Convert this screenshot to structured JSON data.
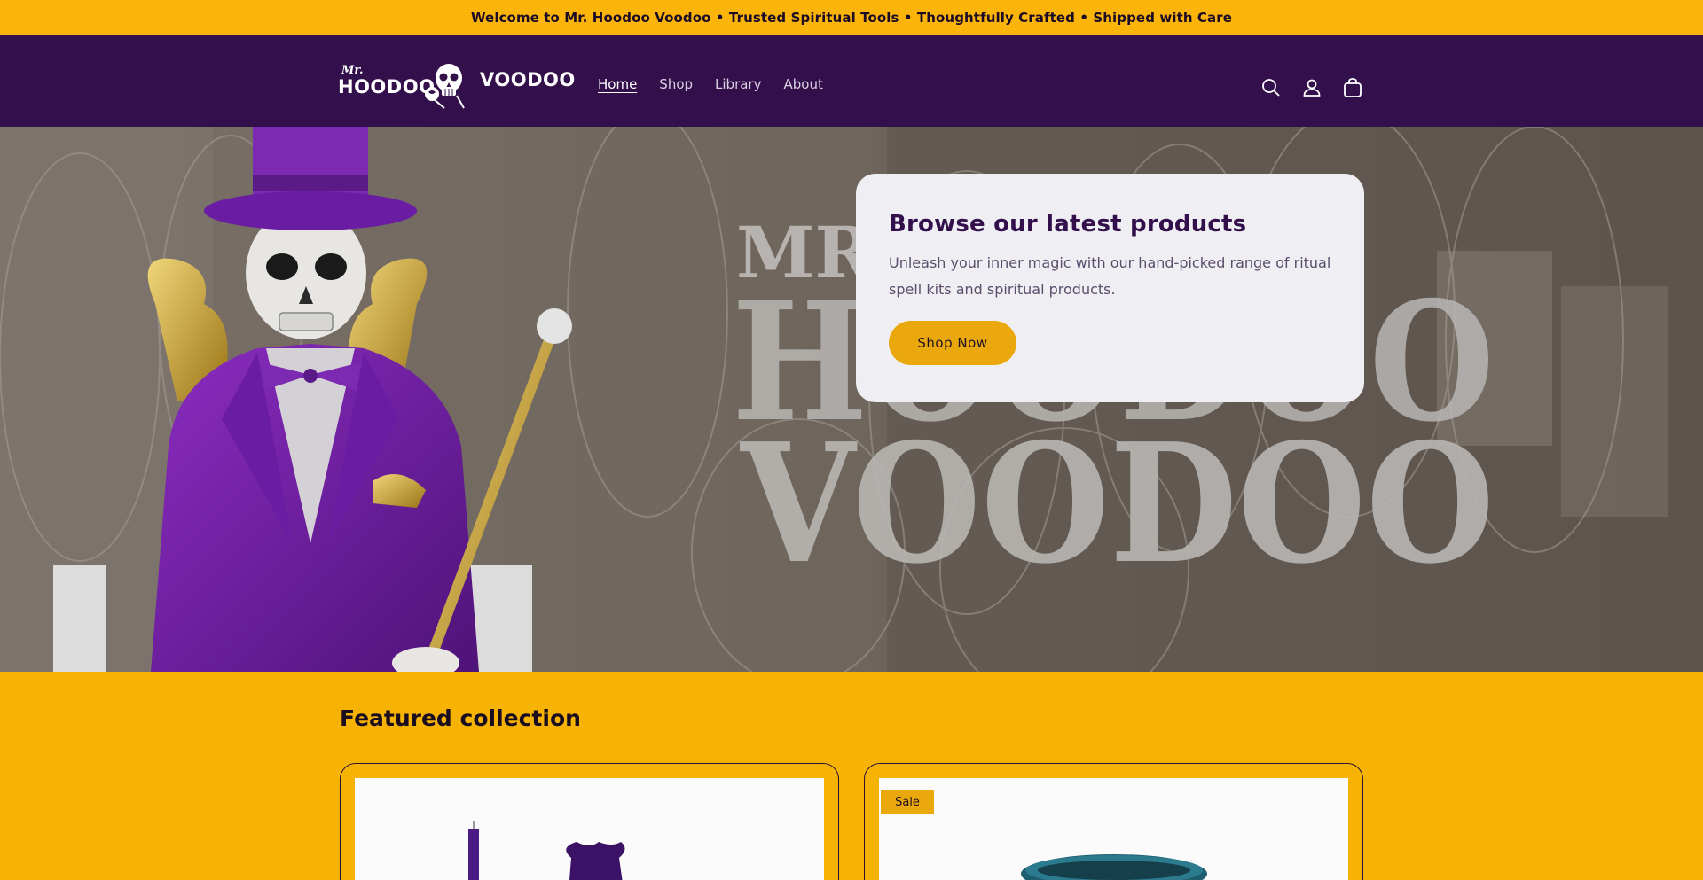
{
  "announcement": "Welcome to Mr. Hoodoo Voodoo • Trusted Spiritual Tools • Thoughtfully Crafted • Shipped with Care",
  "logo": {
    "mr": "Mr.",
    "word1": "HOODOO",
    "word2": "VOODOO"
  },
  "nav": [
    {
      "label": "Home",
      "active": true
    },
    {
      "label": "Shop",
      "active": false
    },
    {
      "label": "Library",
      "active": false
    },
    {
      "label": "About",
      "active": false
    }
  ],
  "header_icons": [
    "search-icon",
    "account-icon",
    "cart-icon"
  ],
  "hero": {
    "bg_text_1": "MR.",
    "bg_text_2": "HOODOO",
    "bg_text_3": "VOODOO",
    "title": "Browse our latest products",
    "description": "Unleash your inner magic with our hand-picked range of ritual spell kits and spiritual products.",
    "button": "Shop Now"
  },
  "featured": {
    "title": "Featured collection",
    "products": [
      {
        "badge": ""
      },
      {
        "badge": "Sale"
      }
    ]
  },
  "colors": {
    "announcement_bg": "#fbb40a",
    "header_bg": "#33104b",
    "accent": "#eba80c",
    "featured_bg": "#f7b304"
  }
}
